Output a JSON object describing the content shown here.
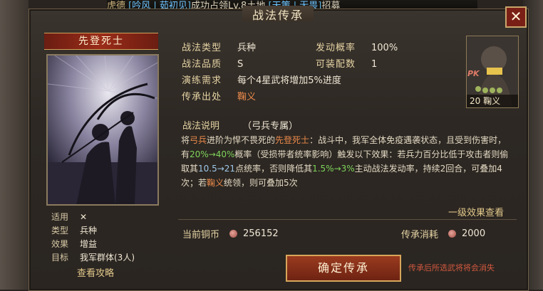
{
  "marquee": {
    "prefix": "虎德",
    "player1": "吟风",
    "player2": "茹初见",
    "action": "成功占领Lv.8土地",
    "alliance1": "天策",
    "alliance2": "无畏",
    "suffix": "招募"
  },
  "panel": {
    "title": "战法传承",
    "close_label": "✕"
  },
  "skill": {
    "name": "先登死士",
    "info": [
      {
        "k": "适用",
        "v": "✕"
      },
      {
        "k": "类型",
        "v": "兵种"
      },
      {
        "k": "效果",
        "v": "增益"
      },
      {
        "k": "目标",
        "v": "我军群体(3人)"
      }
    ],
    "guide_label": "查看攻略"
  },
  "stats": {
    "type_k": "战法类型",
    "type_v": "兵种",
    "prob_k": "发动概率",
    "prob_v": "100%",
    "quality_k": "战法品质",
    "quality_v": "S",
    "slots_k": "可装配数",
    "slots_v": "1",
    "req_k": "演练需求",
    "req_v": "每个4星武将增加5%进度",
    "origin_k": "传承出处",
    "origin_v": "鞠义"
  },
  "general": {
    "level_name": "20 鞠义",
    "pk": "PK"
  },
  "description": {
    "head": "战法说明",
    "tag": "（弓兵专属）",
    "p1_a": "将",
    "p1_b": "弓兵",
    "p1_c": "进阶为悍不畏死的",
    "p1_d": "先登死士",
    "p1_e": "：战斗中，我军全体免疫遇袭状态，且受到伤害时，有",
    "p1_f": "20%→40%",
    "p1_g": "概率（受损带者统率影响）触发以下效果：若兵力百分比低于攻击者则偷取其",
    "p1_h": "10.5→21",
    "p1_i": "点统率，否则降低其",
    "p1_j": "1.5%→3%",
    "p1_k": "主动战法发动率，持续2回合，可叠加4次；若",
    "p1_l": "鞠义",
    "p1_m": "统领，则可叠加5次",
    "level_link": "一级效果查看"
  },
  "currency": {
    "copper_k": "当前铜币",
    "copper_v": "256152",
    "cost_k": "传承消耗",
    "cost_v": "2000"
  },
  "actions": {
    "confirm": "确定传承",
    "warning": "传承后所选武将将会消失"
  }
}
